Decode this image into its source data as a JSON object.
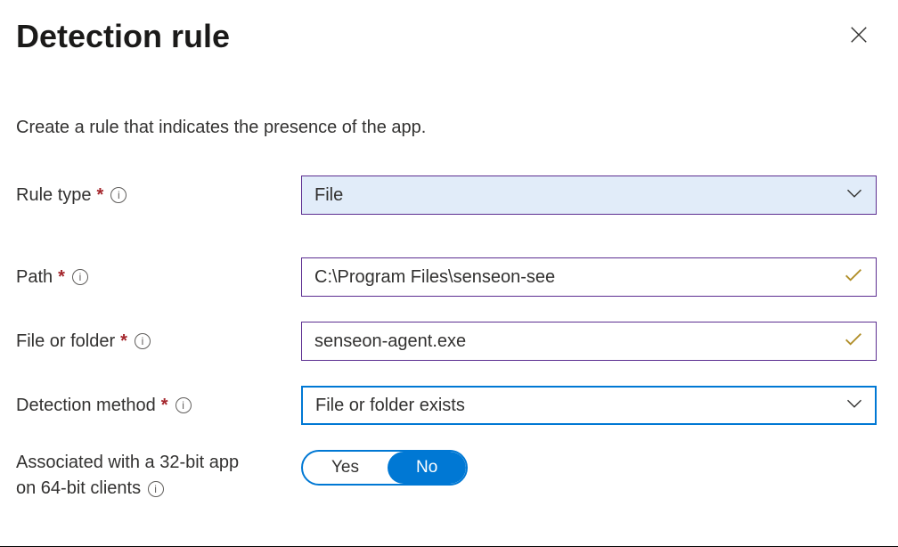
{
  "header": {
    "title": "Detection rule"
  },
  "description": "Create a rule that indicates the presence of the app.",
  "fields": {
    "ruleType": {
      "label": "Rule type",
      "value": "File"
    },
    "path": {
      "label": "Path",
      "value": "C:\\Program Files\\senseon-see"
    },
    "fileOrFolder": {
      "label": "File or folder",
      "value": "senseon-agent.exe"
    },
    "detectionMethod": {
      "label": "Detection method",
      "value": "File or folder exists"
    },
    "associated32bit": {
      "labelLine1": "Associated with a 32-bit app",
      "labelLine2": "on 64-bit clients",
      "yes": "Yes",
      "no": "No",
      "selected": "No"
    }
  }
}
